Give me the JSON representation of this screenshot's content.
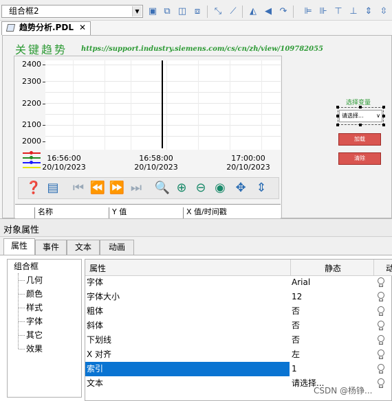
{
  "toolbar": {
    "object_select": "组合框2",
    "icons": [
      "align-objects-icon",
      "group-icon",
      "ungroup-icon",
      "arrange-icon",
      "connector-icon",
      "magic-wand-icon",
      "flip-vertical-icon",
      "rotate-icon",
      "rotate-right-icon",
      "align-left-icon",
      "align-center-icon",
      "align-top-icon",
      "align-middle-icon",
      "distribute-icon",
      "same-size-icon"
    ]
  },
  "editor": {
    "tab_label": "趋势分析.PDL",
    "tab_close": "✕",
    "heading": "关键趋势",
    "url": "https://support.industry.siemens.com/cs/cn/zh/view/109782055"
  },
  "trend": {
    "y_ticks": [
      "2400",
      "2300",
      "2200",
      "2100",
      "2000"
    ],
    "x_ticks": [
      {
        "time": "16:56:00",
        "date": "20/10/2023"
      },
      {
        "time": "16:58:00",
        "date": "20/10/2023"
      },
      {
        "time": "17:00:00",
        "date": "20/10/2023"
      }
    ],
    "legend_colors": [
      "#e02020",
      "#228b22",
      "#1a1aff",
      "#e6e600"
    ],
    "table_headers": [
      "名称",
      "Y 值",
      "X 值/时间戳"
    ]
  },
  "panel": {
    "select_var_label": "选择变量",
    "select_placeholder": "请选择...",
    "load_button": "加载",
    "clear_button": "清除"
  },
  "properties": {
    "title": "对象属性",
    "tabs": [
      "属性",
      "事件",
      "文本",
      "动画"
    ],
    "tree_root": "组合框",
    "tree_items": [
      "几何",
      "颜色",
      "样式",
      "字体",
      "其它",
      "效果"
    ],
    "columns": [
      "属性",
      "静态",
      "动"
    ],
    "rows": [
      {
        "name": "字体",
        "value": "Arial"
      },
      {
        "name": "字体大小",
        "value": "12"
      },
      {
        "name": "粗体",
        "value": "否"
      },
      {
        "name": "斜体",
        "value": "否"
      },
      {
        "name": "下划线",
        "value": "否"
      },
      {
        "name": "X 对齐",
        "value": "左"
      },
      {
        "name": "索引",
        "value": "1"
      },
      {
        "name": "文本",
        "value": "请选择..."
      }
    ],
    "selected_row": "索引"
  },
  "watermark": "CSDN @杨铮..."
}
